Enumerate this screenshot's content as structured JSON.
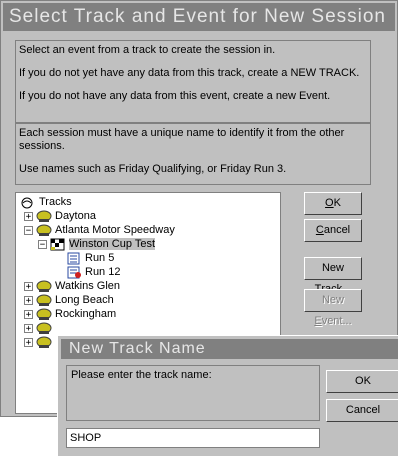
{
  "main_dialog": {
    "title": "Select Track and Event for New Session",
    "info_1": [
      "Select an event from a track to create the session in.",
      "If you do not yet have any data from this track, create a NEW TRACK.",
      "If you do not have any data from this event, create a new Event."
    ],
    "info_2": [
      "Each session must have a unique name to identify it from the other sessions.",
      "Use names such as Friday Qualifying, or Friday Run 3."
    ],
    "buttons": {
      "ok": "OK",
      "cancel": "Cancel",
      "new_track": "New Track...",
      "new_event": "New Event..."
    }
  },
  "tree": {
    "root": "Tracks",
    "daytona": "Daytona",
    "atlanta": "Atlanta Motor Speedway",
    "winston": "Winston Cup Test",
    "run5": "Run 5",
    "run12": "Run 12",
    "watkins": "Watkins Glen",
    "longbeach": "Long Beach",
    "rockingham": "Rockingham"
  },
  "new_track_dialog": {
    "title": "New Track Name",
    "prompt": "Please enter the track name:",
    "input_value": "SHOP",
    "ok": "OK",
    "cancel": "Cancel"
  },
  "colors": {
    "face": "#c0c0c0",
    "title_bar": "#808080",
    "title_text": "#e6e6e6",
    "track_icon": "#c8c020",
    "event_icon": "#2a4aa0",
    "error_mark": "#d02020"
  }
}
